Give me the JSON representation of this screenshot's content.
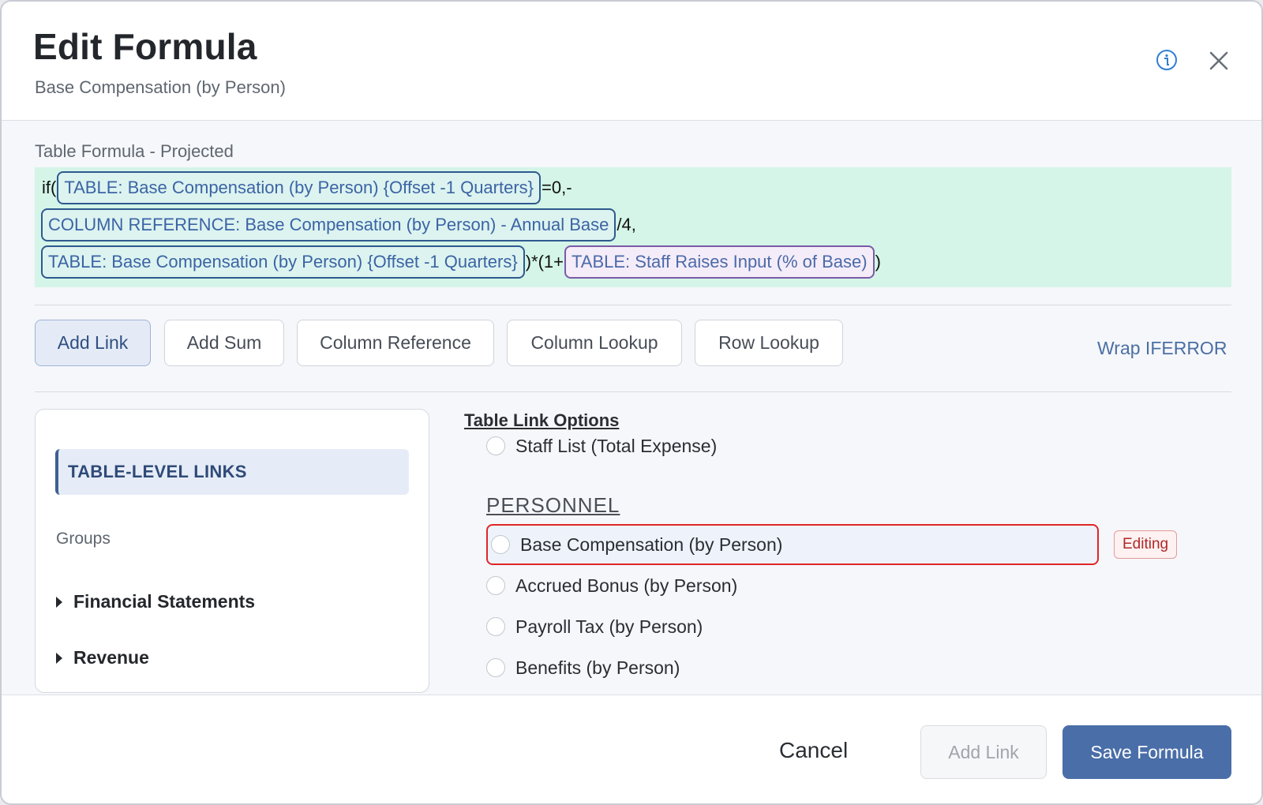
{
  "header": {
    "title": "Edit Formula",
    "subtitle": "Base Compensation (by Person)"
  },
  "icons": {
    "info": "info-circle-icon",
    "close": "close-icon",
    "group_toggle": "triangle-right-icon"
  },
  "formula": {
    "label": "Table Formula - Projected",
    "line1": {
      "prefix": "if(",
      "chip": "TABLE: Base Compensation (by Person) {Offset -1 Quarters}",
      "suffix": "=0,-"
    },
    "line2": {
      "chip": "COLUMN REFERENCE: Base Compensation (by Person) - Annual Base",
      "suffix": "/4,"
    },
    "line3": {
      "chip1": "TABLE: Base Compensation (by Person) {Offset -1 Quarters}",
      "mid": ")*(1+",
      "chip2": "TABLE: Staff Raises Input (% of Base)",
      "suffix": ")"
    }
  },
  "toolbar": {
    "buttons": [
      "Add Link",
      "Add Sum",
      "Column Reference",
      "Column Lookup",
      "Row Lookup"
    ],
    "active": "Add Link",
    "wrap_iferror": "Wrap IFERROR"
  },
  "left_panel": {
    "table_level": "TABLE-LEVEL LINKS",
    "groups_label": "Groups",
    "groups": [
      "Financial Statements",
      "Revenue"
    ]
  },
  "options": {
    "title": "Table Link Options",
    "top_item": "Staff List (Total Expense)",
    "section": "PERSONNEL",
    "editing_item": "Base Compensation (by Person)",
    "editing_badge": "Editing",
    "items": [
      "Accrued Bonus (by Person)",
      "Payroll Tax (by Person)",
      "Benefits (by Person)"
    ]
  },
  "footer": {
    "cancel": "Cancel",
    "add_link": "Add Link",
    "save": "Save Formula"
  },
  "colors": {
    "accent": "#4a6ea8",
    "formula_bg": "#d4f5e8",
    "editing_border": "#e02626"
  }
}
